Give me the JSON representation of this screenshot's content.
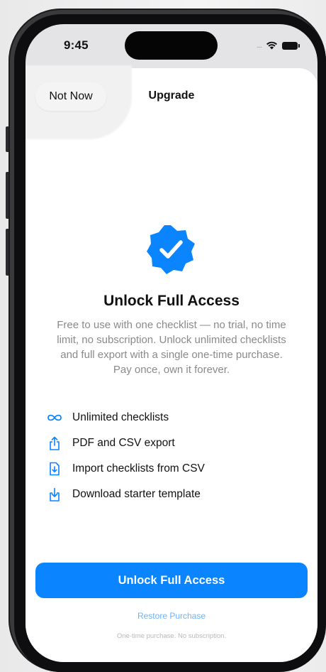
{
  "status_bar": {
    "time": "9:45",
    "signal_text": "....",
    "icons": [
      "wifi-icon",
      "battery-icon"
    ]
  },
  "nav": {
    "dismiss_label": "Not Now",
    "title": "Upgrade"
  },
  "hero": {
    "icon": "verified-badge-icon",
    "headline": "Unlock Full Access",
    "description": "Free to use with one checklist — no trial, no time limit, no subscription. Unlock unlimited checklists and full export with a single one-time purchase. Pay once, own it forever."
  },
  "features": [
    {
      "icon": "infinity-icon",
      "label": "Unlimited checklists"
    },
    {
      "icon": "share-export-icon",
      "label": "PDF and CSV export"
    },
    {
      "icon": "document-import-icon",
      "label": "Import checklists from CSV"
    },
    {
      "icon": "download-tray-icon",
      "label": "Download starter template"
    }
  ],
  "actions": {
    "primary_label": "Unlock Full Access",
    "restore_label": "Restore Purchase",
    "footnote": "One-time purchase. No subscription."
  },
  "colors": {
    "accent": "#0a84ff",
    "restore_link": "#6ab4ff",
    "secondary_text": "#8a8a8e"
  }
}
